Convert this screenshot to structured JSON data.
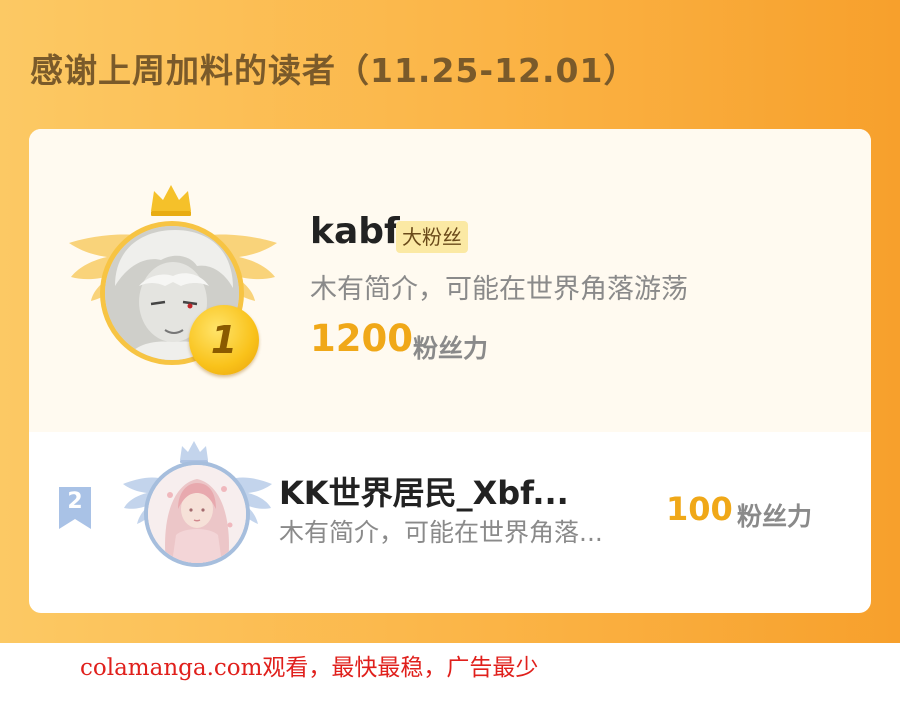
{
  "header": {
    "title": "感谢上周加料的读者（11.25-12.01）"
  },
  "leaderboard": {
    "entries": [
      {
        "rank": "1",
        "name": "kabf",
        "badge": "大粉丝",
        "bio": "木有简介，可能在世界角落游荡",
        "score": "1200",
        "score_unit": "粉丝力"
      },
      {
        "rank": "2",
        "name": "KK世界居民_Xbf...",
        "bio": "木有简介，可能在世界角落...",
        "score": "100",
        "score_unit": "粉丝力"
      }
    ]
  },
  "footer": {
    "watermark": "colamanga.com观看，最快最稳，广告最少"
  },
  "colors": {
    "banner_start": "#fcc964",
    "banner_end": "#f7a02c",
    "score": "#f0a818",
    "gold": "#f7c443",
    "silver": "#a6bedd"
  }
}
